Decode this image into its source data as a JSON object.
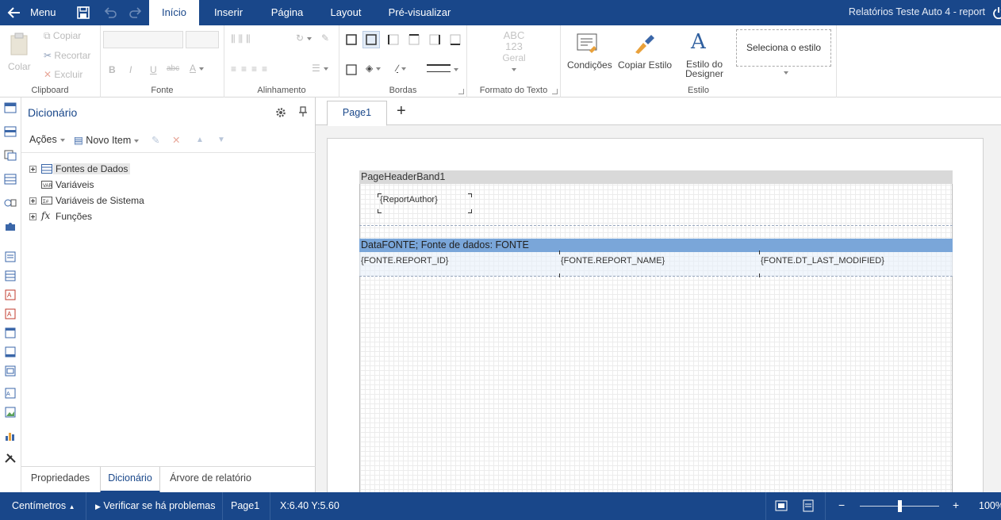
{
  "topbar": {
    "menu_label": "Menu",
    "tabs": [
      "Início",
      "Inserir",
      "Página",
      "Layout",
      "Pré-visualizar"
    ],
    "active_tab": "Início",
    "report_title": "Relatórios Teste Auto 4 - report"
  },
  "ribbon": {
    "clipboard": {
      "paste": "Colar",
      "copy": "Copiar",
      "cut": "Recortar",
      "delete": "Excluir",
      "caption": "Clipboard"
    },
    "font": {
      "caption": "Fonte",
      "bold": "B",
      "italic": "I",
      "underline": "U",
      "strike": "abc"
    },
    "alignment": {
      "caption": "Alinhamento"
    },
    "borders": {
      "caption": "Bordas"
    },
    "text_format": {
      "caption": "Formato do Texto",
      "preview_line1": "ABC",
      "preview_line2": "123",
      "preview_line3": "Geral"
    },
    "style": {
      "caption": "Estilo",
      "conditions": "Condições",
      "copy_style": "Copiar Estilo",
      "designer_style_line1": "Estilo do",
      "designer_style_line2": "Designer",
      "select_style": "Seleciona o estilo"
    }
  },
  "dictionary": {
    "title": "Dicionário",
    "actions": "Ações",
    "new_item": "Novo Item",
    "tree": [
      {
        "label": "Fontes de Dados",
        "expandable": true,
        "icon": "datasource-icon"
      },
      {
        "label": "Variáveis",
        "expandable": false,
        "icon": "variable-icon"
      },
      {
        "label": "Variáveis de Sistema",
        "expandable": true,
        "icon": "system-variable-icon"
      },
      {
        "label": "Funções",
        "expandable": true,
        "icon": "function-icon"
      }
    ],
    "bottom_tabs": [
      "Propriedades",
      "Dicionário",
      "Árvore de relatório"
    ],
    "active_bottom_tab": "Dicionário"
  },
  "workspace": {
    "page_tab": "Page1",
    "add_tab": "+",
    "header_band": "PageHeaderBand1",
    "report_author": "{ReportAuthor}",
    "data_band": "DataFONTE; Fonte de dados: FONTE",
    "fields": [
      "{FONTE.REPORT_ID}",
      "{FONTE.REPORT_NAME}",
      "{FONTE.DT_LAST_MODIFIED}"
    ]
  },
  "statusbar": {
    "units": "Centímetros",
    "check_issues": "Verificar se há problemas",
    "page": "Page1",
    "coords": "X:6.40 Y:5.60",
    "zoom_minus": "−",
    "zoom_plus": "+",
    "zoom": "100%",
    "zoom_fraction": 0.5
  },
  "colors": {
    "brand": "#19478a",
    "data_band": "#7aa6d9",
    "header_band": "#d9d9d9"
  }
}
